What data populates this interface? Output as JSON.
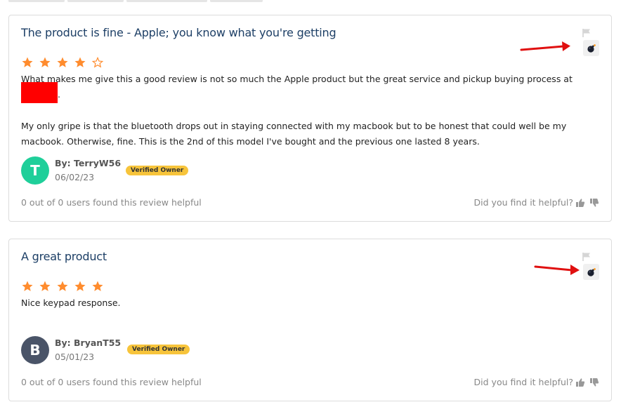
{
  "colors": {
    "title": "#1d3f66",
    "star": "#ff8c2e",
    "badge": "#f7c43b",
    "arrow": "#e01010",
    "avatar_1": "#1fcf9a",
    "avatar_2": "#4a5468"
  },
  "reviews": [
    {
      "title": "The product is fine - Apple; you know what you're getting",
      "rating": 4,
      "max_rating": 5,
      "paragraph_1_before": "What makes me give this a good review is not so much the Apple product but the great service and pickup buying process at",
      "paragraph_1_after": ".",
      "paragraph_2": "My only gripe is that the bluetooth drops out in staying connected with my macbook but to be honest that could well be my macbook. Otherwise, fine. This is the 2nd of this model I've bought and the previous one lasted 8 years.",
      "avatar_letter": "T",
      "author": "By: TerryW56",
      "date": "06/02/23",
      "badge": "Verified Owner",
      "helpful_count": "0 out of 0 users found this review helpful",
      "helpful_question": "Did you find it helpful?"
    },
    {
      "title": "A great product",
      "rating": 5,
      "max_rating": 5,
      "body": "Nice keypad response.",
      "avatar_letter": "B",
      "author": "By: BryanT55",
      "date": "05/01/23",
      "badge": "Verified Owner",
      "helpful_count": "0 out of 0 users found this review helpful",
      "helpful_question": "Did you find it helpful?"
    }
  ],
  "icons": {
    "flag": "flag-icon",
    "bomb": "bomb-icon",
    "thumbs_up": "thumbs-up-icon",
    "thumbs_down": "thumbs-down-icon",
    "star_filled": "star-filled-icon",
    "star_empty": "star-empty-icon"
  }
}
